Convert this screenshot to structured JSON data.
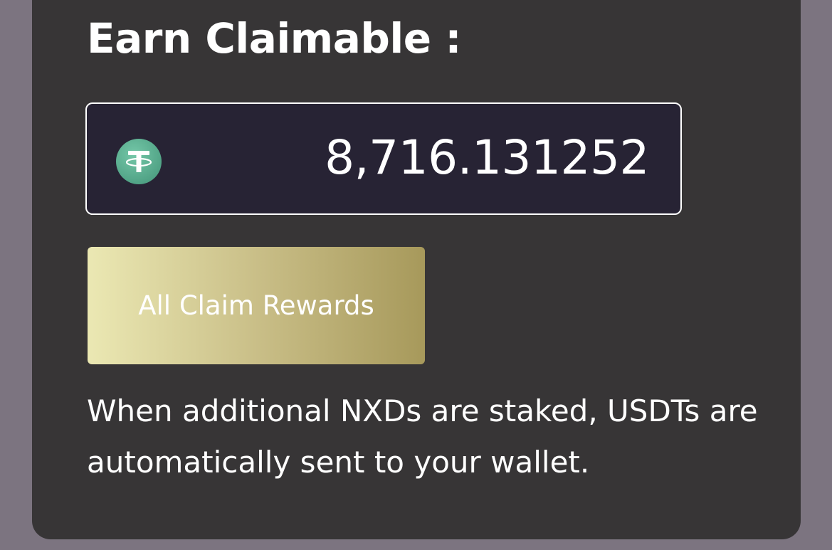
{
  "claim": {
    "title": "Earn Claimable :",
    "token_icon": "tether-usdt-icon",
    "amount": "8,716.131252",
    "button_label": "All Claim Rewards",
    "note": "When additional NXDs are staked, USDTs are automatically sent to your wallet."
  },
  "colors": {
    "page_background": "#7c7480",
    "card_background": "#373536",
    "amount_box_background": "#272334",
    "token_green": "#5fae91",
    "button_gradient": [
      "#ebe8b3",
      "#c8bd86",
      "#a7995b"
    ],
    "text": "#ffffff"
  }
}
